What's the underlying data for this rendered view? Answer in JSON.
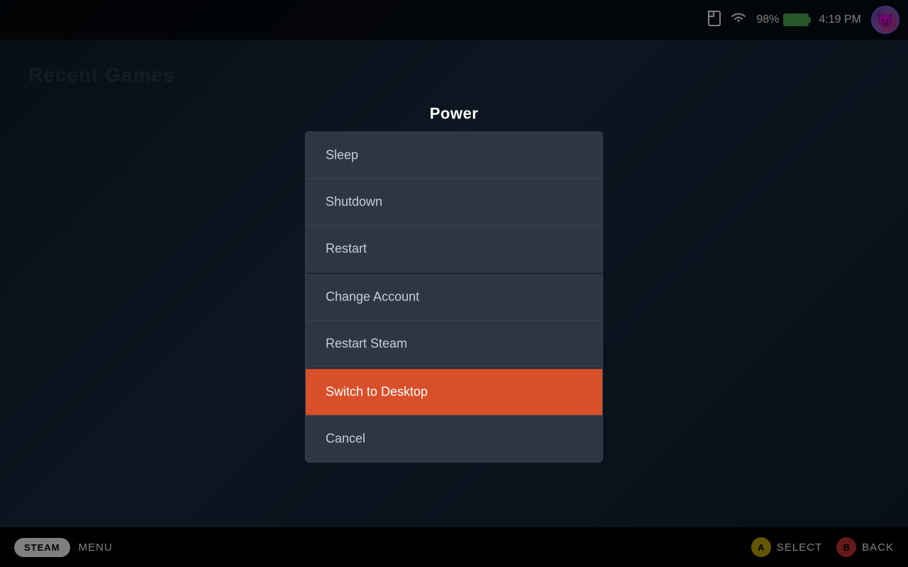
{
  "statusBar": {
    "battery_percent": "98%",
    "time": "4:19 PM"
  },
  "background": {
    "section_title": "Recent Games"
  },
  "modal": {
    "title": "Power",
    "items": [
      {
        "id": "sleep",
        "label": "Sleep",
        "active": false,
        "separator_before": false
      },
      {
        "id": "shutdown",
        "label": "Shutdown",
        "active": false,
        "separator_before": false
      },
      {
        "id": "restart",
        "label": "Restart",
        "active": false,
        "separator_before": false
      },
      {
        "id": "change-account",
        "label": "Change Account",
        "active": false,
        "separator_before": true
      },
      {
        "id": "restart-steam",
        "label": "Restart Steam",
        "active": false,
        "separator_before": false
      },
      {
        "id": "switch-to-desktop",
        "label": "Switch to Desktop",
        "active": true,
        "separator_before": true
      },
      {
        "id": "cancel",
        "label": "Cancel",
        "active": false,
        "separator_before": false
      }
    ]
  },
  "bottomBar": {
    "steam_label": "STEAM",
    "menu_label": "MENU",
    "select_label": "SELECT",
    "back_label": "BACK"
  }
}
